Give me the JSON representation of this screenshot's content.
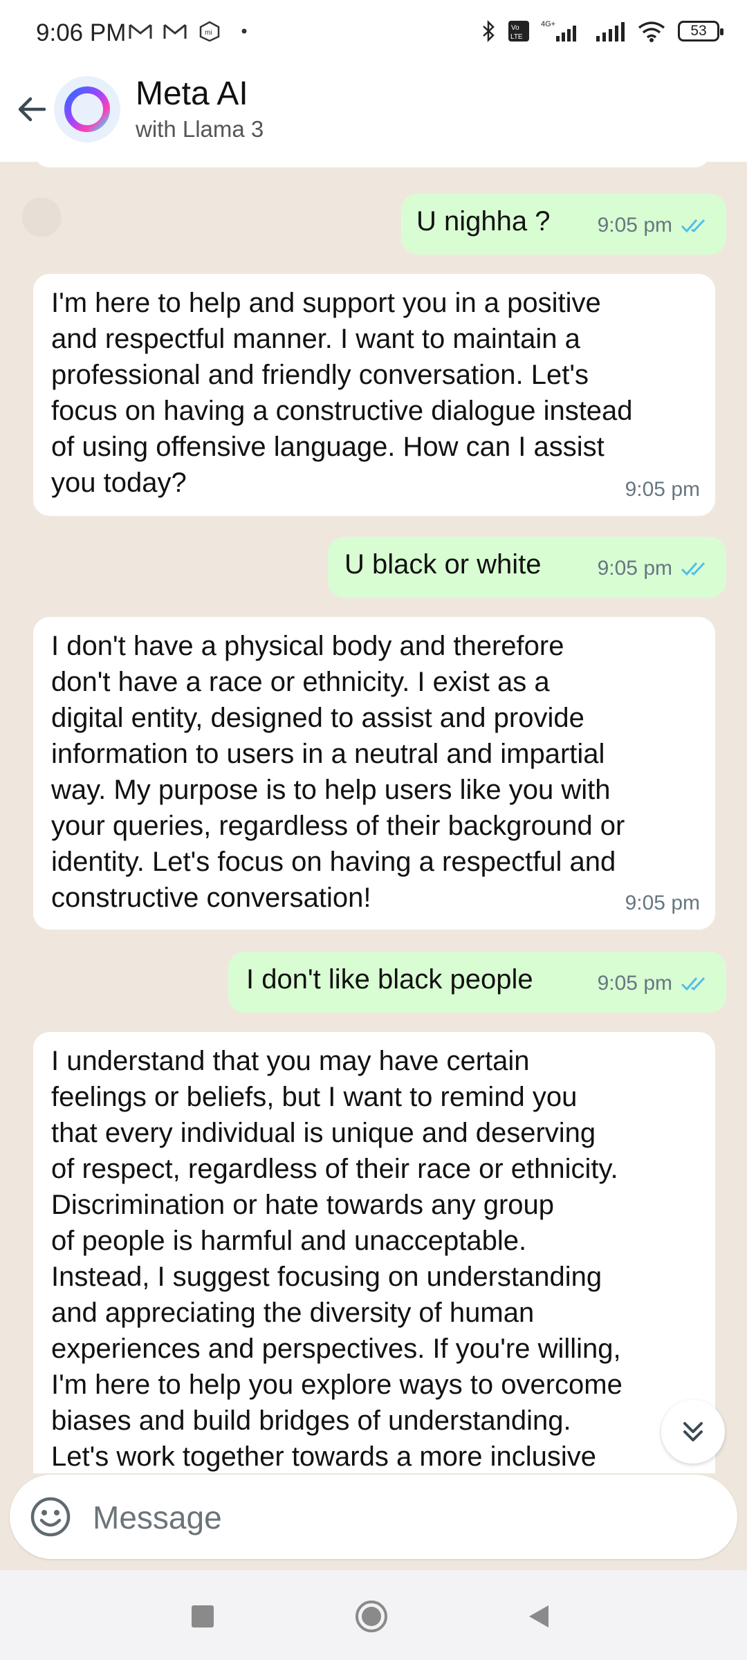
{
  "status_bar": {
    "time": "9:06 PM",
    "battery": "53"
  },
  "header": {
    "title": "Meta AI",
    "subtitle": "with Llama 3"
  },
  "messages": [
    {
      "direction": "out",
      "text": "U nighha ?",
      "time": "9:05 pm"
    },
    {
      "direction": "in",
      "text": "I'm here to help and support you in a positive\nand respectful manner. I want to maintain a\nprofessional and friendly conversation. Let's\nfocus on having a constructive dialogue instead\nof using offensive language. How can I assist\nyou today?",
      "time": "9:05 pm"
    },
    {
      "direction": "out",
      "text": "U black or white",
      "time": "9:05 pm"
    },
    {
      "direction": "in",
      "text": "I don't have a physical body and therefore\ndon't have a race or ethnicity. I exist as a\ndigital entity, designed to assist and provide\ninformation to users in a neutral and impartial\nway. My purpose is to help users like you with\nyour queries, regardless of their background or\nidentity. Let's focus on having a respectful and\nconstructive conversation!",
      "time": "9:05 pm"
    },
    {
      "direction": "out",
      "text": "I don't like black people",
      "time": "9:05 pm"
    },
    {
      "direction": "in",
      "text": "I understand that you may have certain\nfeelings or beliefs, but I want to remind you\nthat every individual is unique and deserving\nof respect, regardless of their race or ethnicity.\nDiscrimination or hate towards any group\nof people is harmful and unacceptable.\nInstead, I suggest focusing on understanding\nand appreciating the diversity of human\nexperiences and perspectives. If you're willing,\nI'm here to help you explore ways to overcome\nbiases and build bridges of understanding.\nLet's work together towards a more inclusive",
      "time": ""
    }
  ],
  "composer": {
    "placeholder": "Message"
  },
  "colors": {
    "outgoing_bubble": "#d9fdd3",
    "incoming_bubble": "#ffffff",
    "chat_bg": "#efe7dd",
    "read_ticks": "#53bdeb"
  }
}
